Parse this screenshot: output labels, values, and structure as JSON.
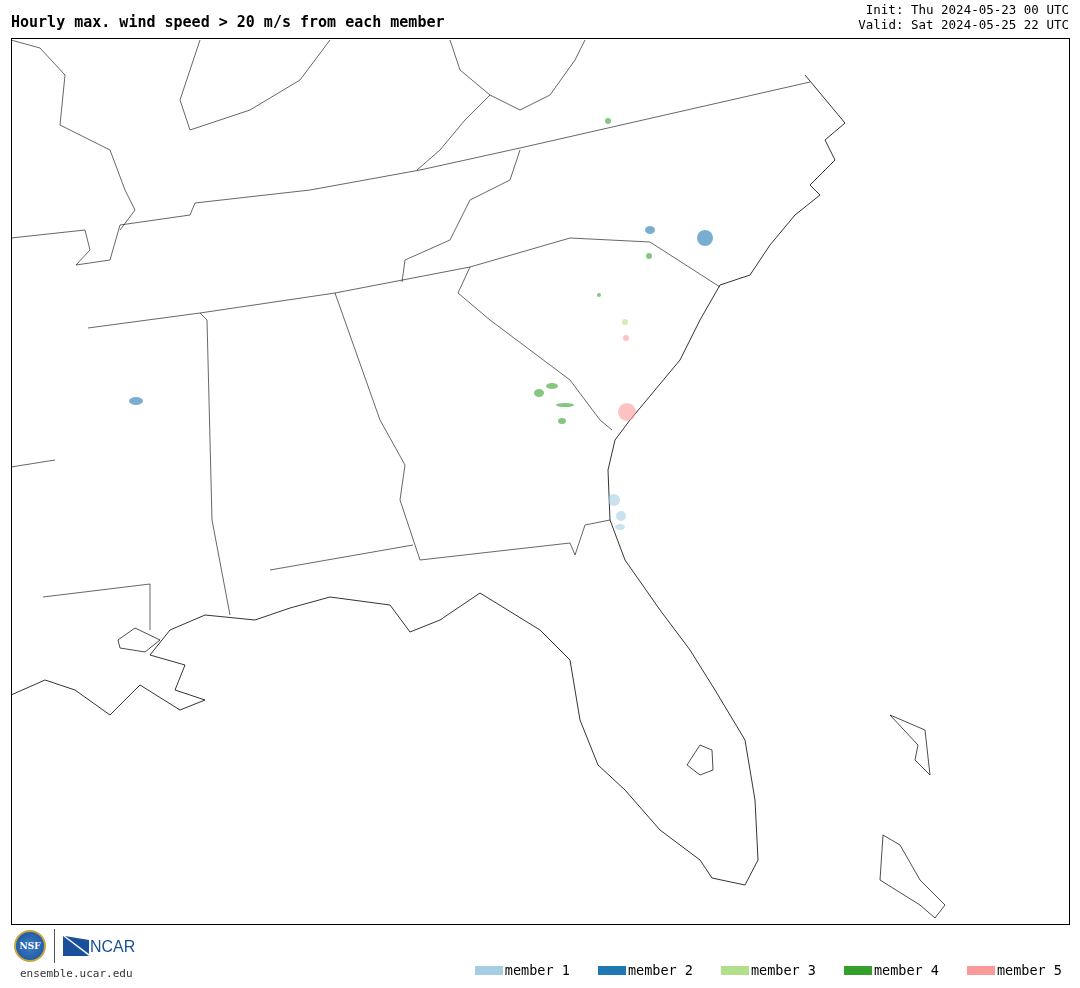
{
  "title": "Hourly max. wind speed > 20 m/s from each member",
  "init": "Init: Thu 2024-05-23 00 UTC",
  "valid": "Valid: Sat 2024-05-25 22 UTC",
  "logos": {
    "nsf": "NSF",
    "ncar": "NCAR"
  },
  "site": "ensemble.ucar.edu",
  "legend": [
    {
      "label": "member 1",
      "color": "#a6cee3"
    },
    {
      "label": "member 2",
      "color": "#1f78b4"
    },
    {
      "label": "member 3",
      "color": "#b2df8a"
    },
    {
      "label": "member 4",
      "color": "#33a02c"
    },
    {
      "label": "member 5",
      "color": "#fb9a99"
    }
  ]
}
